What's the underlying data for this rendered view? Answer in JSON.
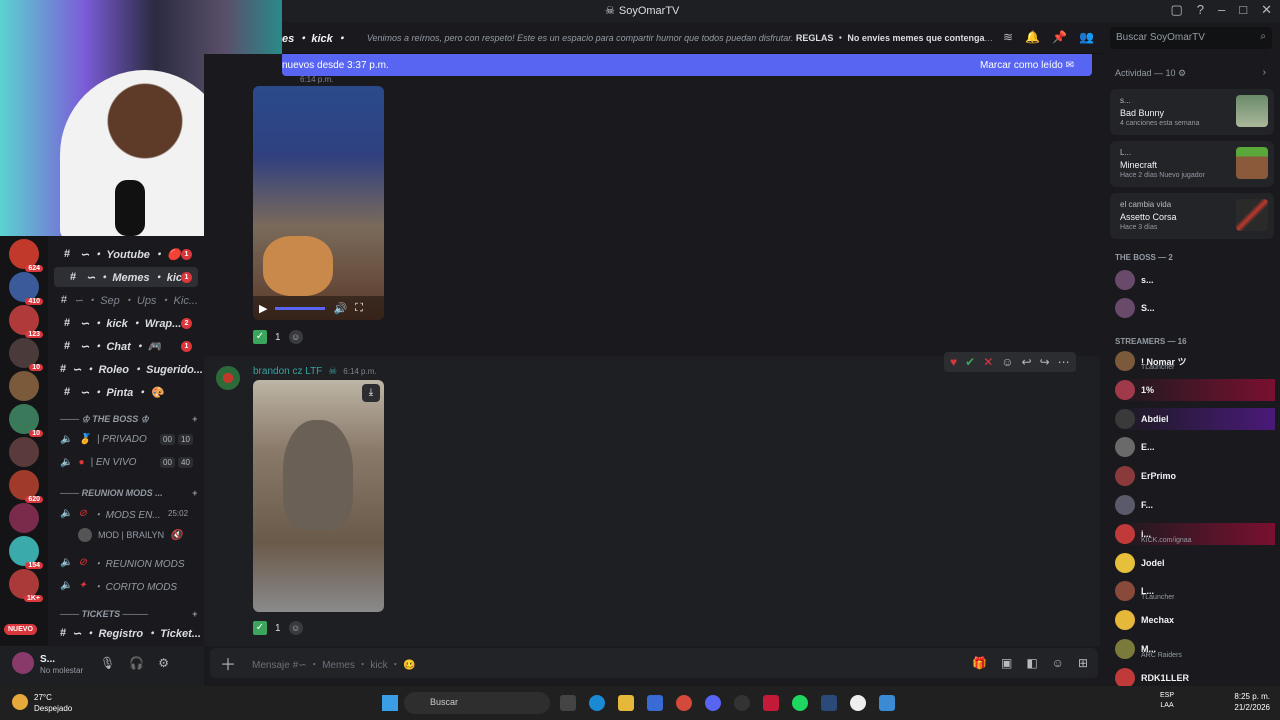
{
  "window": {
    "title": "SoyOmarTV"
  },
  "header": {
    "channel": "es ・ kick ・",
    "topic_italic": "Venimos a reírnos, pero con respeto! Este es un espacio para compartir humor que todos puedan disfrutar.",
    "topic_bold": "REGLAS ・ No envíes memes que contengan m...",
    "search_placeholder": "Buscar SoyOmarTV"
  },
  "new_messages": {
    "text": "nuevos desde 3:37 p.m.",
    "mark_read": "Marcar como leído"
  },
  "guilds": [
    {
      "count": "624"
    },
    {
      "count": "410"
    },
    {
      "count": "123"
    },
    {
      "count": "10"
    },
    {
      "count": ""
    },
    {
      "count": "10"
    },
    {
      "count": ""
    },
    {
      "count": "620"
    },
    {
      "count": ""
    },
    {
      "count": "154"
    },
    {
      "count": "1K+"
    }
  ],
  "guild_new_label": "NUEVO",
  "channels": [
    {
      "name": "∽ ・ Youtube ・ 🔴",
      "badge": "1",
      "style": ""
    },
    {
      "name": "∽ ・ Memes ・ kic...",
      "badge": "1",
      "style": "sel"
    },
    {
      "name": "∽ ・ Sep ・ Ups ・ Kic...",
      "badge": "",
      "style": "dim"
    },
    {
      "name": "∽ ・ kick ・ Wrap...",
      "badge": "2",
      "style": ""
    },
    {
      "name": "∽ ・ Chat ・ 🎮",
      "badge": "1",
      "style": ""
    },
    {
      "name": "∽ ・ Roleo ・ Sugerido...",
      "badge": "",
      "style": ""
    },
    {
      "name": "∽ ・ Pinta ・ 🎨",
      "badge": "",
      "style": ""
    }
  ],
  "categories": {
    "boss": "THE BOSS",
    "reunion": "REUNION MODS ...",
    "tickets": "TICKETS"
  },
  "voice": {
    "privado": "| PRIVADO",
    "privado_count": "00",
    "privado_cap": "10",
    "envivo": "| EN VIVO",
    "envivo_count": "00",
    "envivo_cap": "40",
    "mods_en": "・ MODS EN...",
    "mods_en_time": "25:02",
    "mod_user": "MOD | BRAILYN",
    "reunion_mods": "・ REUNION MODS",
    "corito": "・ CORITO MODS",
    "registro": "∽ ・ Registro ・ Ticket..."
  },
  "user_panel": {
    "name": "S...",
    "status": "No molestar"
  },
  "messages": {
    "top_author_time": "6:14 p.m.",
    "reaction1": "1",
    "author2": "brandon cz LTF",
    "author2_time": "6:14 p.m.",
    "reaction2": "1"
  },
  "composer": {
    "placeholder": "Mensaje #∽ ・ Memes ・ kick ・ 🥴"
  },
  "sidebar": {
    "activity_head": "Actividad — 10",
    "cards": [
      {
        "user": "s...",
        "title": "Bad Bunny",
        "sub": "4 canciones esta semana"
      },
      {
        "user": "L...",
        "title": "Minecraft",
        "sub": "Hace 2 días  Nuevo jugador"
      },
      {
        "user": "el cambia vida",
        "title": "Assetto Corsa",
        "sub": "Hace 3 días"
      }
    ],
    "boss_head": "THE BOSS — 2",
    "boss_members": [
      {
        "name": "s..."
      },
      {
        "name": "S..."
      }
    ],
    "streamers_head": "STREAMERS — 16",
    "streamers": [
      {
        "name": "! Nomar ツ",
        "sub": "TLauncher"
      },
      {
        "name": "1%",
        "sub": ""
      },
      {
        "name": "Abdiel",
        "sub": ""
      },
      {
        "name": "E...",
        "sub": ""
      },
      {
        "name": "ErPrimo",
        "sub": ""
      },
      {
        "name": "F...",
        "sub": ""
      },
      {
        "name": "i...",
        "sub": "KICK.com/ignaa"
      },
      {
        "name": "Jodel",
        "sub": ""
      },
      {
        "name": "L...",
        "sub": "TLauncher"
      },
      {
        "name": "Mechax",
        "sub": ""
      },
      {
        "name": "M...",
        "sub": "ARC Raiders"
      },
      {
        "name": "RDK1LLER",
        "sub": ""
      }
    ]
  },
  "taskbar": {
    "temp": "27°C",
    "weather": "Despejado",
    "search": "Buscar",
    "lang1": "ESP",
    "lang2": "LAA",
    "time": "8:25 p. m.",
    "date": "21/2/2026"
  }
}
